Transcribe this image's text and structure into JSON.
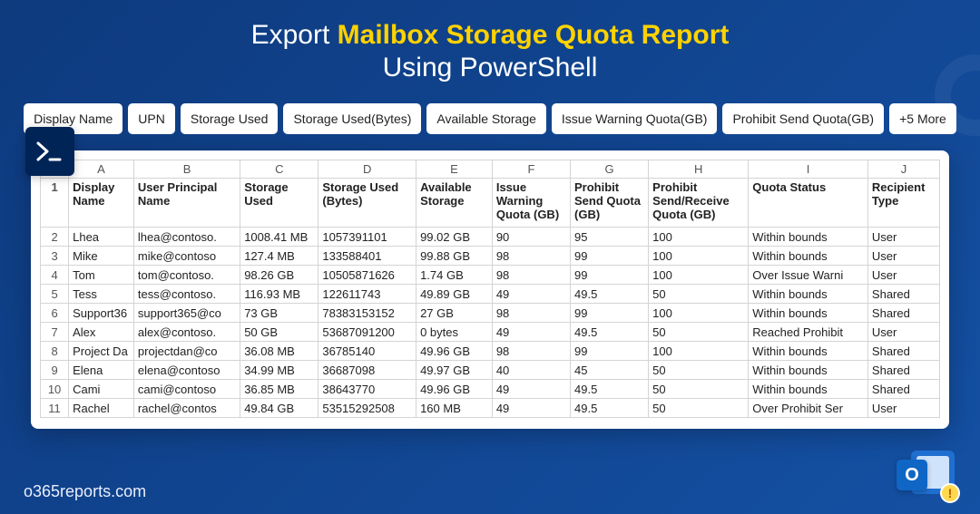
{
  "heading": {
    "prefix": "Export",
    "accent": "Mailbox Storage Quota Report",
    "line2": "Using PowerShell"
  },
  "tags": [
    "Display Name",
    "UPN",
    "Storage Used",
    "Storage Used(Bytes)",
    "Available Storage",
    "Issue Warning Quota(GB)",
    "Prohibit Send Quota(GB)",
    "+5 More"
  ],
  "columns_letters": [
    "A",
    "B",
    "C",
    "D",
    "E",
    "F",
    "G",
    "H",
    "I",
    "J"
  ],
  "column_headers": [
    "Display Name",
    "User Principal Name",
    "Storage Used",
    "Storage Used (Bytes)",
    "Available Storage",
    "Issue Warning Quota (GB)",
    "Prohibit Send Quota (GB)",
    "Prohibit Send/Receive Quota (GB)",
    "Quota Status",
    "Recipient Type"
  ],
  "rows": [
    {
      "n": "2",
      "c": [
        "Lhea",
        "lhea@contoso.",
        "1008.41 MB",
        "1057391101",
        "99.02 GB",
        "90",
        "95",
        "100",
        "Within bounds",
        "User"
      ]
    },
    {
      "n": "3",
      "c": [
        "Mike",
        "mike@contoso",
        "127.4 MB",
        "133588401",
        "99.88 GB",
        "98",
        "99",
        "100",
        "Within bounds",
        "User"
      ]
    },
    {
      "n": "4",
      "c": [
        "Tom",
        "tom@contoso.",
        "98.26 GB",
        "10505871626",
        "1.74 GB",
        "98",
        "99",
        "100",
        "Over Issue Warni",
        "User"
      ]
    },
    {
      "n": "5",
      "c": [
        "Tess",
        "tess@contoso.",
        "116.93 MB",
        "122611743",
        "49.89 GB",
        "49",
        "49.5",
        "50",
        "Within bounds",
        "Shared"
      ]
    },
    {
      "n": "6",
      "c": [
        "Support36",
        "support365@co",
        "73 GB",
        "78383153152",
        "27 GB",
        "98",
        "99",
        "100",
        "Within bounds",
        "Shared"
      ]
    },
    {
      "n": "7",
      "c": [
        "Alex",
        "alex@contoso.",
        "50 GB",
        "53687091200",
        "0 bytes",
        "49",
        "49.5",
        "50",
        "Reached Prohibit",
        "User"
      ]
    },
    {
      "n": "8",
      "c": [
        "Project Da",
        "projectdan@co",
        "36.08 MB",
        "36785140",
        "49.96 GB",
        "98",
        "99",
        "100",
        "Within bounds",
        "Shared"
      ]
    },
    {
      "n": "9",
      "c": [
        "Elena",
        "elena@contoso",
        "34.99 MB",
        "36687098",
        "49.97 GB",
        "40",
        "45",
        "50",
        "Within bounds",
        "Shared"
      ]
    },
    {
      "n": "10",
      "c": [
        "Cami",
        "cami@contoso",
        "36.85 MB",
        "38643770",
        "49.96 GB",
        "49",
        "49.5",
        "50",
        "Within bounds",
        "Shared"
      ]
    },
    {
      "n": "11",
      "c": [
        "Rachel",
        "rachel@contos",
        "49.84 GB",
        "53515292508",
        "160 MB",
        "49",
        "49.5",
        "50",
        "Over Prohibit Ser",
        "User"
      ]
    }
  ],
  "footer": "o365reports.com",
  "icons": {
    "powershell": "powershell-icon",
    "outlook": "outlook-icon",
    "alert": "!"
  }
}
